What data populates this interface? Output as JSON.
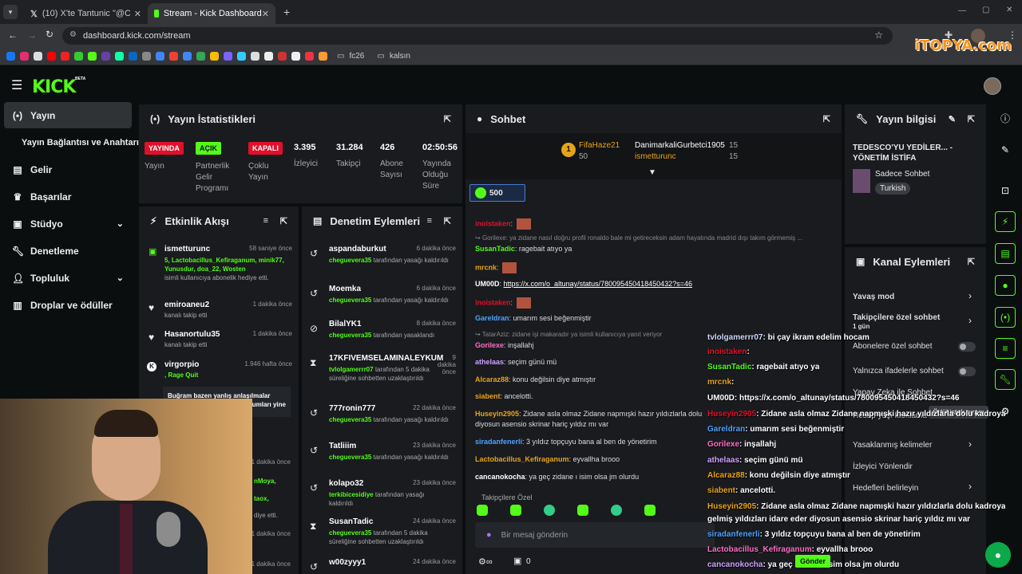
{
  "browser": {
    "tabs": [
      {
        "title": "(10) X'te Tantunic \"@CemSeak1:"
      },
      {
        "title": "Stream - Kick Dashboard"
      }
    ],
    "url": "dashboard.kick.com/stream",
    "bookmarks": [
      "fc26",
      "kalsın"
    ],
    "watermark": "iTOPYA.com"
  },
  "app": {
    "logo": "KICK",
    "beta": "BETA"
  },
  "sidebar": {
    "items": [
      {
        "label": "Yayın",
        "icon": "broadcast-icon"
      },
      {
        "label": "Yayın Bağlantısı ve Anahtarı"
      },
      {
        "label": "Gelir",
        "icon": "chart-icon"
      },
      {
        "label": "Başarılar",
        "icon": "trophy-icon"
      },
      {
        "label": "Stüdyo",
        "icon": "studio-icon"
      },
      {
        "label": "Denetleme",
        "icon": "wrench-icon"
      },
      {
        "label": "Topluluk",
        "icon": "people-icon"
      },
      {
        "label": "Droplar ve ödüller",
        "icon": "gift-icon"
      }
    ]
  },
  "stats": {
    "title": "Yayın İstatistikleri",
    "items": [
      {
        "badge": "YAYINDA",
        "label": "Yayın"
      },
      {
        "badge": "AÇIK",
        "label": "Partnerlik Gelir Programı"
      },
      {
        "badge": "KAPALI",
        "label": "Çoklu Yayın"
      },
      {
        "value": "3.395",
        "label": "İzleyici"
      },
      {
        "value": "31.284",
        "label": "Takipçi"
      },
      {
        "value": "426",
        "label": "Abone Sayısı"
      },
      {
        "value": "02:50:56",
        "label": "Yayında Olduğu Süre"
      }
    ]
  },
  "activity": {
    "title": "Etkinlik Akışı",
    "items": [
      {
        "name": "ismetturunc",
        "time": "58 saniye önce",
        "detail": "5, Lactobacillus_Kefiraganum, minik77, Yunusdur, doa_22, Wosten",
        "sub": "isimli kullanıcıya abonelik hediye etti."
      },
      {
        "name": "emiroaneu2",
        "time": "1 dakika önce",
        "sub": "kanalı takip etti"
      },
      {
        "name": "Hasanortulu35",
        "time": "1 dakika önce",
        "sub": "kanalı takip etti"
      },
      {
        "name": "virgorpio",
        "time": "1.946 hafta önce",
        "detail": ", Rage Quit"
      },
      {
        "msg": "Buğram bazen yanlış anlaşılmalar",
        "msg2": "umları yine"
      },
      {
        "time": "1 dakika önce"
      },
      {
        "time": "1 dakika önce"
      },
      {
        "time": "1 dakika önce"
      }
    ],
    "fragments": [
      "nMoya,",
      "taox,",
      "diye etti."
    ]
  },
  "moderation": {
    "title": "Denetim Eylemleri",
    "items": [
      {
        "name": "aspandaburkut",
        "time": "6 dakika önce",
        "by": "cheguevera35",
        "sub": "tarafından yasağı kaldırıldı"
      },
      {
        "name": "Moemka",
        "time": "6 dakika önce",
        "by": "cheguevera35",
        "sub": "tarafından yasağı kaldırıldı"
      },
      {
        "name": "BilalYK1",
        "time": "8 dakika önce",
        "by": "cheguevera35",
        "sub": "tarafından yasaklandı"
      },
      {
        "name": "17KFIVEMSELAMINALEYKUM",
        "time": "9 dakika önce",
        "by": "tvlolgamerrr07",
        "sub": "tarafından 5 dakika süreliğine sohbetten uzaklaştırıldı"
      },
      {
        "name": "777ronin777",
        "time": "22 dakika önce",
        "by": "cheguevera35",
        "sub": "tarafından yasağı kaldırıldı"
      },
      {
        "name": "Tatliiim",
        "time": "23 dakika önce",
        "by": "cheguevera35",
        "sub": "tarafından yasağı kaldırıldı"
      },
      {
        "name": "kolapo32",
        "time": "23 dakika önce",
        "by": "terkibicesidiye",
        "sub": "tarafından yasağı kaldırıldı"
      },
      {
        "name": "SusanTadic",
        "time": "24 dakika önce",
        "by": "cheguevera35",
        "sub": "tarafından 5 dakika süreliğine sohbetten uzaklaştırıldı"
      },
      {
        "name": "w00zyyy1",
        "time": "24 dakika önce"
      }
    ]
  },
  "chat": {
    "title": "Sohbet",
    "leader1": {
      "name": "FifaHaze21",
      "count": "50"
    },
    "leader2": {
      "name": "DanimarkaliGurbetci1905",
      "count": "15"
    },
    "leader3": {
      "name": "ismetturunc",
      "count": "15"
    },
    "viewer_pill": "500",
    "lines": [
      {
        "user": "inoistaken",
        "text": ""
      },
      {
        "reply": "Gorilexe: ya zidane nasıl doğru profil ronaldo bale mi getireceksin adam hayatında madrid dışı takım görmemiş ..."
      },
      {
        "user": "SusanTadic",
        "text": "ragebait atıyo ya"
      },
      {
        "user": "mrcnk",
        "text": ""
      },
      {
        "user": "UM00D",
        "text": "https://x.com/o_altunay/status/780095450418450432?s=46"
      },
      {
        "user": "inoistaken",
        "text": ""
      },
      {
        "user": "Gareldran",
        "text": "umarım sesi beğenmiştir"
      },
      {
        "reply": "TatarAziz: zidane işi makaradır ya isimli kullanıcıya yanıt veriyor"
      },
      {
        "user": "Gorilexe",
        "text": "inşallahj"
      },
      {
        "user": "athelaas",
        "text": "seçim günü mü"
      },
      {
        "user": "Alcaraz88",
        "text": "konu değilsin diye atmıştır"
      },
      {
        "user": "siabent",
        "text": "ancelotti."
      },
      {
        "user": "Huseyin2905",
        "text": "Zidane asla olmaz Zidane napmışki hazır yıldızlarla dolu"
      },
      {
        "text": "diyosun asensio skrinar hariç yıldız mı var"
      },
      {
        "user": "siradanfenerli",
        "text": "3 yıldız topçuyu bana al ben de yönetirim"
      },
      {
        "user": "Lactobacillus_Kefiraganum",
        "text": "eyvallha brooo"
      },
      {
        "user": "cancanokocha",
        "text": "ya geç zidane ı isim olsa jm olurdu"
      }
    ],
    "followers_only": "Takipçilere Özel",
    "input_placeholder": "Bir mesaj gönderin",
    "bottom_count": "0"
  },
  "overlay_chat": [
    {
      "user": "tvlolgamerrr07",
      "text": ": bi çay ikram edelim hocam"
    },
    {
      "user": "inoistaken",
      "text": ":"
    },
    {
      "user": "SusanTadic",
      "text": ": ragebait atıyo ya"
    },
    {
      "user": "mrcnk",
      "text": ":"
    },
    {
      "user": "UM00D",
      "text": ": https://x.com/o_altunay/status/780095450418450432?s=46"
    },
    {
      "user": "Huseyin2905",
      "text": ": Zidane asla olmaz Zidane napmışki hazır yıldızlarla dolu kadroya"
    },
    {
      "user": "Gareldran",
      "text": ": umarım sesi beğenmiştir"
    },
    {
      "user": "Gorilexe",
      "text": ": inşallahj"
    },
    {
      "user": "athelaas",
      "text": ": seçim günü mü"
    },
    {
      "user": "Alcaraz88",
      "text": ": konu değilsin diye atmıştır"
    },
    {
      "user": "siabent",
      "text": ": ancelotti."
    },
    {
      "user": "Huseyin2905",
      "text": ": Zidane asla olmaz Zidane napmışki hazır yıldızlarla dolu kadroya"
    },
    {
      "text": "gelmiş yıldızları idare eder diyosun asensio skrinar hariç yıldız mı var"
    },
    {
      "user": "siradanfenerli",
      "text": ": 3 yıldız topçuyu bana al ben de yönetirim"
    },
    {
      "user": "Lactobacillus_Kefiraganum",
      "text": ": eyvallha brooo"
    },
    {
      "user": "cancanokocha",
      "text": ": ya geç zidane ı isim olsa jm olurdu"
    }
  ],
  "stream_info": {
    "title": "Yayın bilgisi",
    "stream_title": "TEDESCO'YU YEDİLER... - YÖNETİM İSTİFA",
    "category": "Sadece Sohbet",
    "language": "Turkish"
  },
  "channel_actions": {
    "title": "Kanal Eylemleri",
    "items": [
      {
        "label": "Yavaş mod"
      },
      {
        "label": "Takipçilere özel sohbet",
        "sub": "1 gün"
      },
      {
        "label": "Abonelere özel sohbet"
      },
      {
        "label": "Yalnızca ifadelerle sohbet"
      },
      {
        "label": "Yapay Zeka ile Sohbet"
      },
      {
        "label": "Hesap yaşı kısıtlama"
      },
      {
        "label": "Yasaklanmış kelimeler"
      },
      {
        "label": "İzleyici Yönlendir"
      },
      {
        "label": "Hedefleri belirleyin"
      }
    ],
    "tooltip": "Ödül istek sırası"
  },
  "overlay_button": "Gönder"
}
